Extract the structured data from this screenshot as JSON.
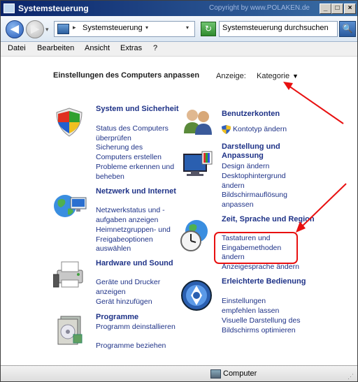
{
  "window": {
    "title": "Systemsteuerung",
    "copyright": "Copyright by www.POLAKEN.de",
    "min": "_",
    "max": "□",
    "close": "×"
  },
  "address": {
    "back": "◀",
    "forward": "▶",
    "history": "▾",
    "separator": "▸",
    "path": "Systemsteuerung",
    "path_dropdown": "▾",
    "dropdown": "▾",
    "refresh": "↻",
    "search_placeholder": "Systemsteuerung durchsuchen",
    "search_btn": "🔍"
  },
  "menu": [
    "Datei",
    "Bearbeiten",
    "Ansicht",
    "Extras",
    "?"
  ],
  "content": {
    "heading": "Einstellungen des Computers anpassen",
    "view_label": "Anzeige:",
    "view_value": "Kategorie",
    "view_arrow": "▼"
  },
  "categories": {
    "system": {
      "title": "System und Sicherheit",
      "links": [
        "Status des Computers überprüfen",
        "Sicherung des Computers erstellen",
        "Probleme erkennen und beheben"
      ]
    },
    "network": {
      "title": "Netzwerk und Internet",
      "links": [
        "Netzwerkstatus und -aufgaben anzeigen",
        "Heimnetzgruppen- und Freigabeoptionen auswählen"
      ]
    },
    "hardware": {
      "title": "Hardware und Sound",
      "links": [
        "Geräte und Drucker anzeigen",
        "Gerät hinzufügen"
      ]
    },
    "programs": {
      "title": "Programme",
      "links": [
        "Programm deinstallieren",
        "Programme beziehen"
      ]
    },
    "users": {
      "title": "Benutzerkonten",
      "links": [
        "Kontotyp ändern"
      ]
    },
    "appearance": {
      "title": "Darstellung und Anpassung",
      "links": [
        "Design ändern",
        "Desktophintergrund ändern",
        "Bildschirmauflösung anpassen"
      ]
    },
    "clock": {
      "title": "Zeit, Sprache und Region",
      "links": [
        "Tastaturen und Eingabemethoden ändern",
        "Anzeigesprache ändern"
      ]
    },
    "access": {
      "title": "Erleichterte Bedienung",
      "links": [
        "Einstellungen empfehlen lassen",
        "Visuelle Darstellung des Bildschirms optimieren"
      ]
    }
  },
  "status": {
    "text": "Computer",
    "grip": "⋰"
  },
  "colors": {
    "link": "#1e3287",
    "annotation": "#e81010"
  }
}
